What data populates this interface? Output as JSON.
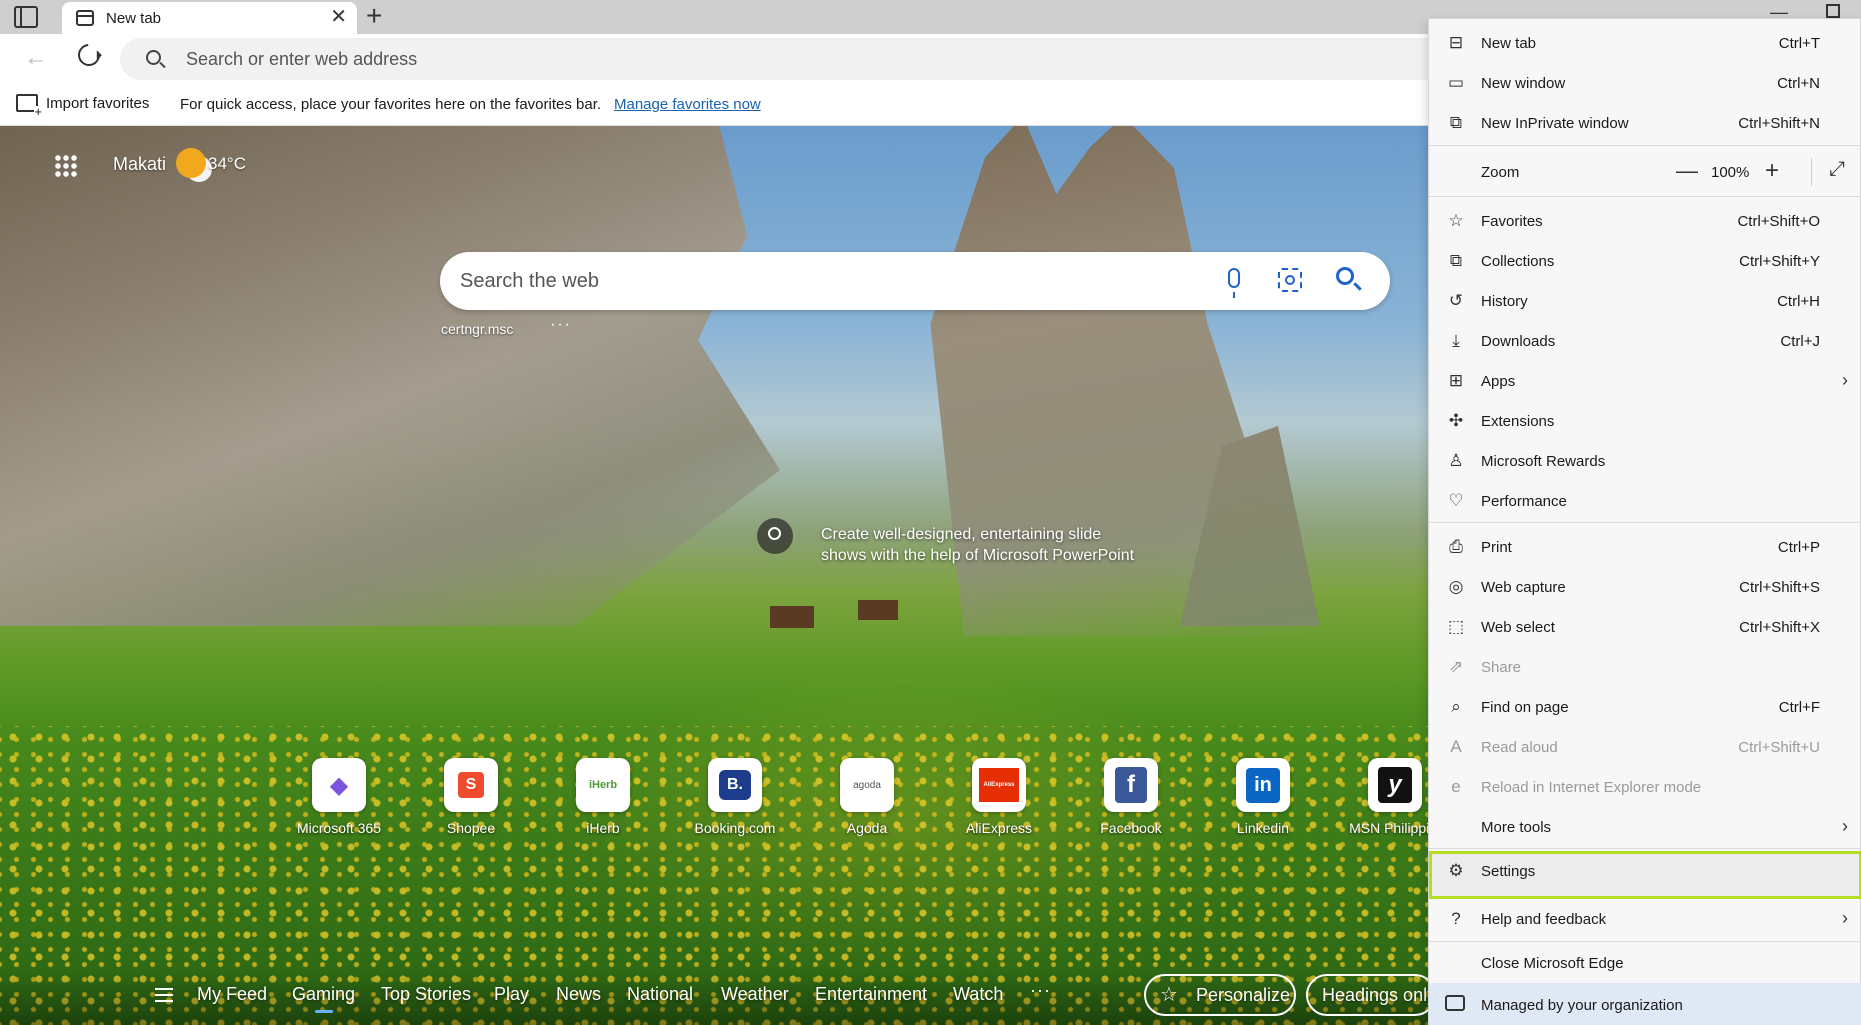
{
  "tab": {
    "title": "New tab"
  },
  "address": {
    "placeholder": "Search or enter web address"
  },
  "favorites_bar": {
    "import_label": "Import favorites",
    "message": "For quick access, place your favorites here on the favorites bar.",
    "manage_link": "Manage favorites now"
  },
  "newtab": {
    "location": "Makati",
    "temperature": "34°C",
    "search_placeholder": "Search the web",
    "recent_search": "certngr.msc",
    "recent_more": "···",
    "insight_text": "Create well-designed, entertaining slide shows with the help of Microsoft PowerPoint",
    "quick_links": [
      {
        "label": "Microsoft 365",
        "glyph": "◆",
        "color": "#7b55e0"
      },
      {
        "label": "Shopee",
        "glyph": "S",
        "color": "#ee4d2d"
      },
      {
        "label": "iHerb",
        "glyph": "iHerb",
        "color": "#4c9b2e"
      },
      {
        "label": "Booking.com",
        "glyph": "B.",
        "color": "#1e3c8c"
      },
      {
        "label": "Agoda",
        "glyph": "agoda",
        "color": "#555555"
      },
      {
        "label": "AliExpress",
        "glyph": "AliExpress",
        "color": "#e62e04"
      },
      {
        "label": "Facebook",
        "glyph": "f",
        "color": "#3b5998"
      },
      {
        "label": "Linkedin",
        "glyph": "in",
        "color": "#0a66c2"
      },
      {
        "label": "MSN Philippi...",
        "glyph": "y",
        "color": "#111111"
      }
    ],
    "feed_tabs": [
      "My Feed",
      "Gaming",
      "Top Stories",
      "Play",
      "News",
      "National",
      "Weather",
      "Entertainment",
      "Watch"
    ],
    "feed_active": "Gaming",
    "feed_more": "···",
    "personalize_label": "Personalize",
    "headings_label": "Headings only"
  },
  "menu": {
    "new_tab": {
      "label": "New tab",
      "shortcut": "Ctrl+T"
    },
    "new_window": {
      "label": "New window",
      "shortcut": "Ctrl+N"
    },
    "new_inprivate": {
      "label": "New InPrivate window",
      "shortcut": "Ctrl+Shift+N"
    },
    "zoom": {
      "label": "Zoom",
      "value": "100%"
    },
    "favorites": {
      "label": "Favorites",
      "shortcut": "Ctrl+Shift+O"
    },
    "collections": {
      "label": "Collections",
      "shortcut": "Ctrl+Shift+Y"
    },
    "history": {
      "label": "History",
      "shortcut": "Ctrl+H"
    },
    "downloads": {
      "label": "Downloads",
      "shortcut": "Ctrl+J"
    },
    "apps": {
      "label": "Apps"
    },
    "extensions": {
      "label": "Extensions"
    },
    "rewards": {
      "label": "Microsoft Rewards"
    },
    "performance": {
      "label": "Performance"
    },
    "print": {
      "label": "Print",
      "shortcut": "Ctrl+P"
    },
    "web_capture": {
      "label": "Web capture",
      "shortcut": "Ctrl+Shift+S"
    },
    "web_select": {
      "label": "Web select",
      "shortcut": "Ctrl+Shift+X"
    },
    "share": {
      "label": "Share"
    },
    "find": {
      "label": "Find on page",
      "shortcut": "Ctrl+F"
    },
    "read_aloud": {
      "label": "Read aloud",
      "shortcut": "Ctrl+Shift+U"
    },
    "ie_mode": {
      "label": "Reload in Internet Explorer mode"
    },
    "more_tools": {
      "label": "More tools"
    },
    "settings": {
      "label": "Settings"
    },
    "help": {
      "label": "Help and feedback"
    },
    "close": {
      "label": "Close Microsoft Edge"
    },
    "managed": {
      "label": "Managed by your organization"
    },
    "highlight_color": "#b6dc24"
  }
}
